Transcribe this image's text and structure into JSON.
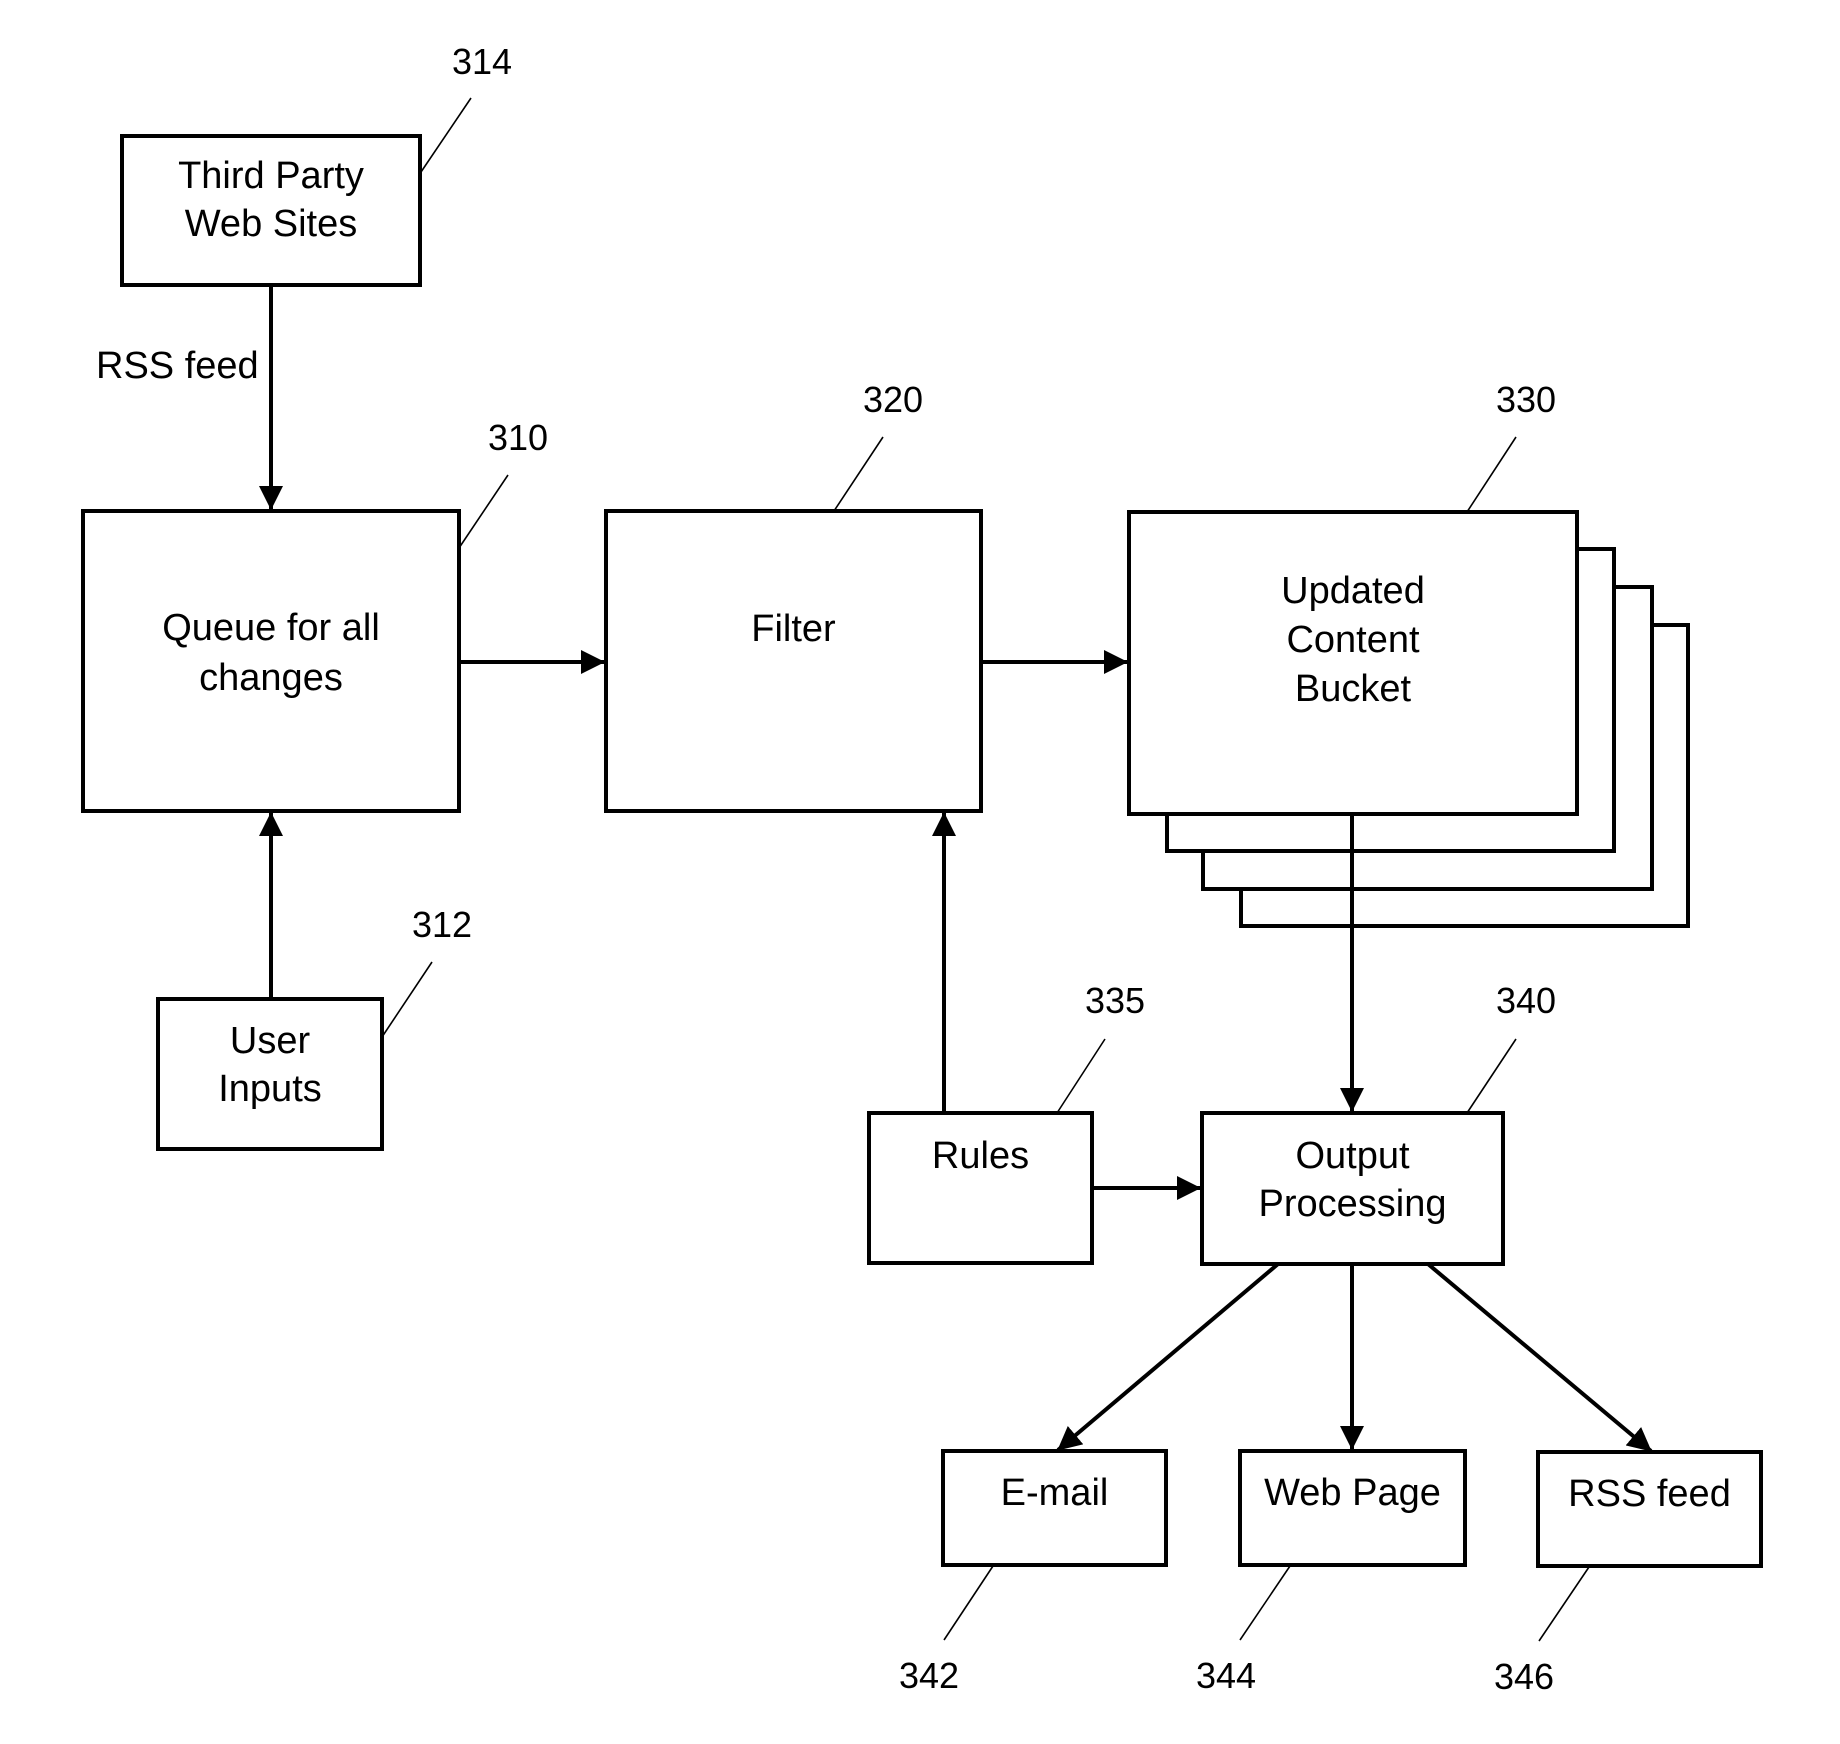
{
  "diagram": {
    "type": "block-flow-diagram",
    "nodes": {
      "third_party": {
        "lines": [
          "Third Party",
          "Web Sites"
        ],
        "ref": "314"
      },
      "queue": {
        "lines": [
          "Queue for all",
          "changes"
        ],
        "ref": "310"
      },
      "user_inputs": {
        "lines": [
          "User",
          "Inputs"
        ],
        "ref": "312"
      },
      "filter": {
        "lines": [
          "Filter"
        ],
        "ref": "320"
      },
      "bucket": {
        "lines": [
          "Updated",
          "Content",
          "Bucket"
        ],
        "ref": "330"
      },
      "rules": {
        "lines": [
          "Rules"
        ],
        "ref": "335"
      },
      "output": {
        "lines": [
          "Output",
          "Processing"
        ],
        "ref": "340"
      },
      "email": {
        "lines": [
          "E-mail"
        ],
        "ref": "342"
      },
      "webpage": {
        "lines": [
          "Web Page"
        ],
        "ref": "344"
      },
      "rss": {
        "lines": [
          "RSS feed"
        ],
        "ref": "346"
      }
    },
    "edges": [
      {
        "from": "third_party",
        "to": "queue",
        "label": "RSS feed"
      },
      {
        "from": "user_inputs",
        "to": "queue",
        "label": ""
      },
      {
        "from": "queue",
        "to": "filter",
        "label": ""
      },
      {
        "from": "filter",
        "to": "bucket",
        "label": ""
      },
      {
        "from": "rules",
        "to": "filter",
        "label": ""
      },
      {
        "from": "bucket",
        "to": "output",
        "label": ""
      },
      {
        "from": "rules",
        "to": "output",
        "label": ""
      },
      {
        "from": "output",
        "to": "email",
        "label": ""
      },
      {
        "from": "output",
        "to": "webpage",
        "label": ""
      },
      {
        "from": "output",
        "to": "rss",
        "label": ""
      }
    ]
  }
}
